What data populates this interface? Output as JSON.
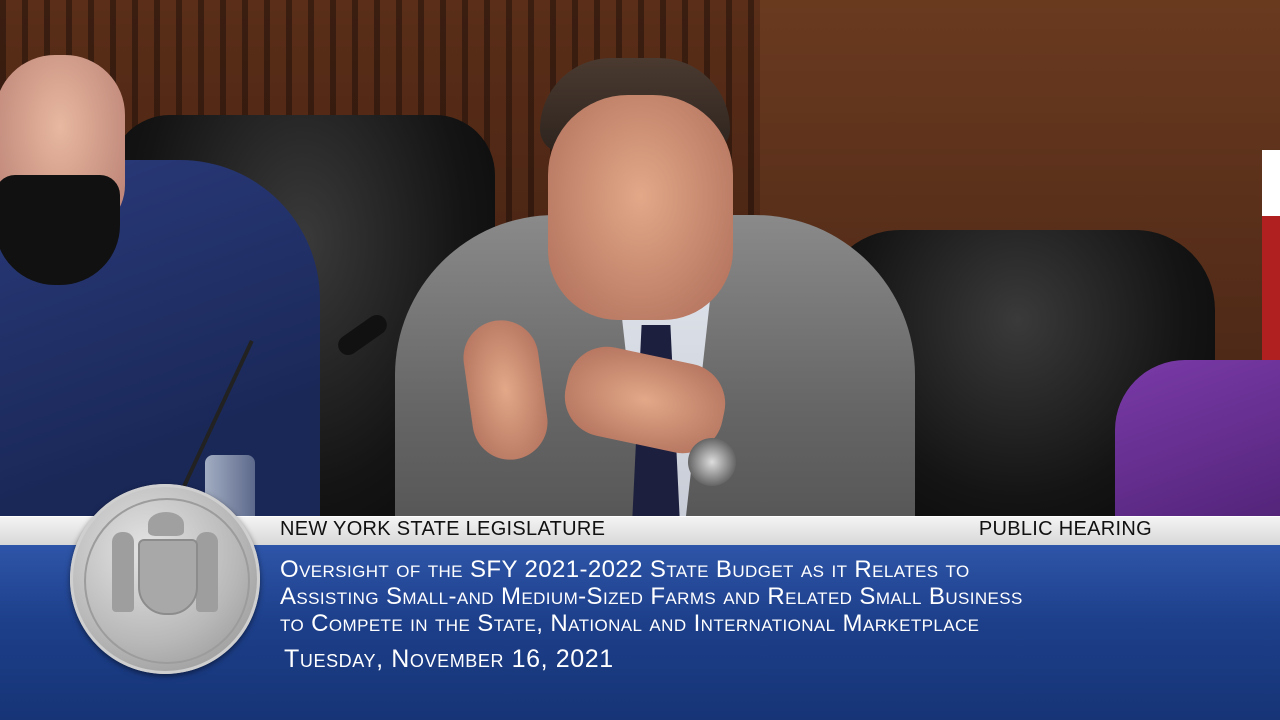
{
  "lower_third": {
    "org": "NEW YORK STATE LEGISLATURE",
    "event_type": "PUBLIC HEARING",
    "title_lines": [
      "Oversight of the SFY 2021-2022 State Budget as it Relates to",
      "Assisting Small-and Medium-Sized Farms and Related Small Business",
      "to Compete in the State, National and International Marketplace"
    ],
    "date": "Tuesday, November 16, 2021"
  },
  "colors": {
    "panel_blue": "#1d3f8a",
    "bar_gray": "#e6e6e6"
  }
}
